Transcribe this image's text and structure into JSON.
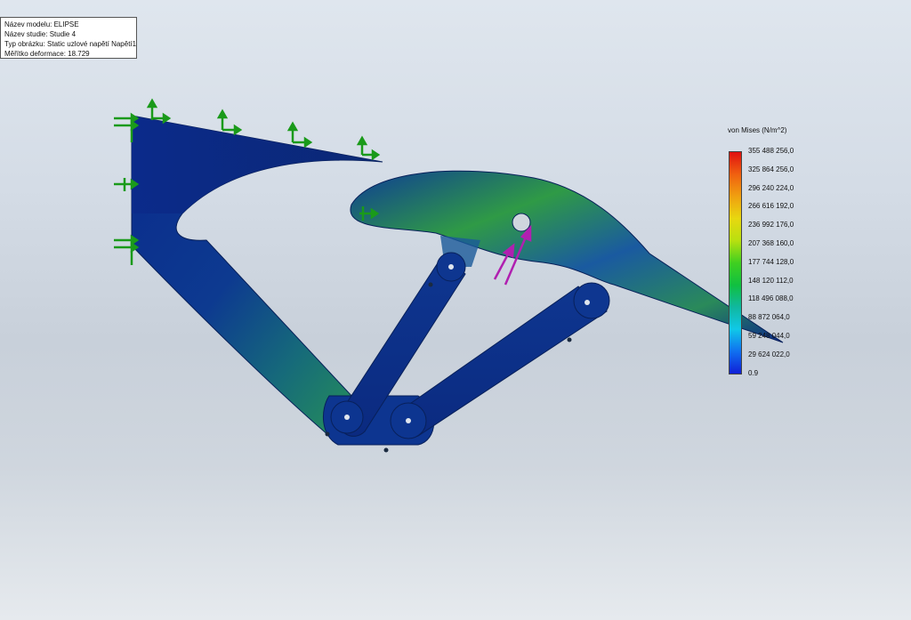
{
  "info": {
    "model_name": "Název modelu: ELIPSE",
    "study_name": "Název studie: Studie 4",
    "plot_type": "Typ obrázku: Static uzlové napětí Napětí1",
    "deformation_scale": "Měřítko deformace: 18.729"
  },
  "legend": {
    "title": "von Mises (N/m^2)",
    "labels": [
      "355 488 256,0",
      "325 864 256,0",
      "296 240 224,0",
      "266 616 192,0",
      "236 992 176,0",
      "207 368 160,0",
      "177 744 128,0",
      "148 120 112,0",
      "118 496 088,0",
      "88 872 064,0",
      "59 248 044,0",
      "29 624 022,0",
      "0.9"
    ],
    "colors": [
      "#e01010",
      "#f06010",
      "#f0a010",
      "#e8d810",
      "#b8e010",
      "#40d020",
      "#10c040",
      "#10b8a0",
      "#10c8e8",
      "#1070f0",
      "#1020d8"
    ]
  },
  "colors": {
    "part_base": "#0b2a8a",
    "stress_high": "#3cb02a",
    "fixture": "#1a9a1a",
    "load": "#b020b0"
  }
}
